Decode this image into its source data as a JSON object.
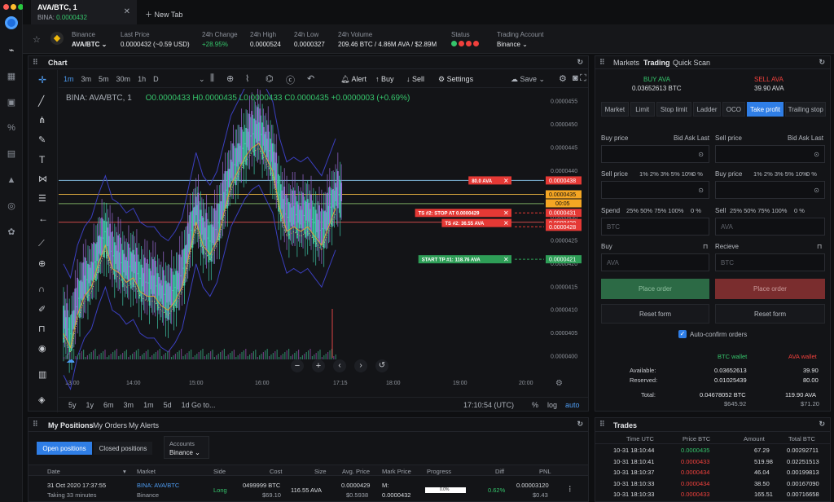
{
  "window": {
    "tab_title": "AVA/BTC, 1",
    "tab_subtitle_pair": "BINA:",
    "tab_subtitle_price": "0.0000432",
    "new_tab": "New Tab"
  },
  "infobar": {
    "exchange": "Binance",
    "pair": "AVA/BTC",
    "last_price_label": "Last Price",
    "last_price": "0.0000432 (~0.59 USD)",
    "change_label": "24h Change",
    "change": "+28.95%",
    "high_label": "24h High",
    "high": "0.0000524",
    "low_label": "24h Low",
    "low": "0.0000327",
    "volume_label": "24h Volume",
    "volume": "209.46 BTC / 4.86M AVA / $2.89M",
    "status_label": "Status",
    "account_label": "Trading Account",
    "account": "Binance"
  },
  "chart_panel": {
    "title": "Chart",
    "timeframes": [
      "1m",
      "3m",
      "5m",
      "30m",
      "1h",
      "D"
    ],
    "alert": "Alert",
    "buy": "Buy",
    "sell": "Sell",
    "settings": "Settings",
    "save": "Save",
    "legend_symbol": "BINA: AVA/BTC, 1",
    "legend_ohlc": "O0.0000433  H0.0000435  L0.0000433  C0.0000435  +0.0000003 (+0.69%)",
    "ranges": [
      "5y",
      "1y",
      "6m",
      "3m",
      "1m",
      "5d",
      "1d"
    ],
    "goto": "Go to...",
    "clock": "17:10:54 (UTC)",
    "pct": "%",
    "log": "log",
    "auto": "auto"
  },
  "chart_data": {
    "type": "candlestick",
    "y_ticks": [
      "0.0000455",
      "0.0000450",
      "0.0000445",
      "0.0000440",
      "0.0000435",
      "0.0000430",
      "0.0000425",
      "0.0000420",
      "0.0000415",
      "0.0000410",
      "0.0000405",
      "0.0000400"
    ],
    "x_ticks": [
      "13:00",
      "14:00",
      "15:00",
      "16:00",
      "17:15",
      "18:00",
      "19:00",
      "20:00"
    ],
    "ylim": [
      3.98e-05,
      4.56e-05
    ],
    "close_path": [
      4.08e-05,
      4.05e-05,
      4.12e-05,
      4.16e-05,
      4.18e-05,
      4.23e-05,
      4.27e-05,
      4.22e-05,
      4.21e-05,
      4.19e-05,
      4.2e-05,
      4.17e-05,
      4.16e-05,
      4.16e-05,
      4.14e-05,
      4.13e-05,
      4.15e-05,
      4.18e-05,
      4.25e-05,
      4.32e-05,
      4.27e-05,
      4.25e-05,
      4.28e-05,
      4.34e-05,
      4.4e-05,
      4.43e-05,
      4.46e-05,
      4.48e-05,
      4.49e-05,
      4.46e-05,
      4.43e-05,
      4.35e-05,
      4.3e-05,
      4.31e-05,
      4.3e-05,
      4.31e-05,
      4.29e-05,
      4.27e-05,
      4.31e-05,
      4.35e-05
    ],
    "order_labels": [
      {
        "text": "80.0 AVA",
        "price": "0.0000438",
        "color": "#e53935"
      },
      {
        "text": "TS #2: STOP AT 0.0000429",
        "price": "0.0000431",
        "color": "#e53935"
      },
      {
        "text": "TS #2: 36.55 AVA",
        "price": "0.0000429",
        "color": "#e53935"
      },
      {
        "text": "START TP #1: 118.76 AVA",
        "price": "0.0000421",
        "color": "#2e9e57"
      }
    ],
    "last_price_tag": "0.0000435",
    "countdown_tag": "00:05",
    "extra_tag": "0.0000428"
  },
  "order_panel": {
    "tabs": [
      "Markets",
      "Trading",
      "Quick Scan"
    ],
    "buy_label": "BUY AVA",
    "buy_value": "0.03652613 BTC",
    "sell_label": "SELL AVA",
    "sell_value": "39.90 AVA",
    "order_types": [
      "Market",
      "Limit",
      "Stop limit",
      "Ladder",
      "OCO",
      "Take profit",
      "Trailing stop"
    ],
    "buy_price": "Buy price",
    "bid_ask_last": "Bid Ask Last",
    "sell_price": "Sell price",
    "pcts": "1% 2% 3% 5% 10%",
    "zero_pct": "0 %",
    "spend": "Spend",
    "spend_pcts": "25% 50% 75% 100%",
    "sell": "Sell",
    "sell_pcts": "25% 50% 75% 100%",
    "btc": "BTC",
    "ava": "AVA",
    "buy": "Buy",
    "recieve": "Recieve",
    "place_order": "Place order",
    "reset_form": "Reset form",
    "auto_confirm": "Auto-confirm orders",
    "btc_wallet": "BTC wallet",
    "ava_wallet": "AVA wallet",
    "available": "Available:",
    "reserved": "Reserved:",
    "total": "Total:",
    "btc_available": "0.03652613",
    "btc_reserved": "0.01025439",
    "btc_total": "0.04678052 BTC",
    "btc_total_usd": "$645.92",
    "ava_available": "39.90",
    "ava_reserved": "80.00",
    "ava_total": "119.90 AVA",
    "ava_total_usd": "$71.20"
  },
  "positions": {
    "tabs": [
      "My Positions",
      "My Orders",
      "My Alerts"
    ],
    "open": "Open positions",
    "closed": "Closed positions",
    "accounts_label": "Accounts",
    "accounts_value": "Binance",
    "headers": [
      "Date",
      "Market",
      "Side",
      "Cost",
      "Size",
      "Avg. Price",
      "Mark Price",
      "Progress",
      "Diff",
      "PNL"
    ],
    "row": {
      "date": "31 Oct 2020 17:37:55",
      "duration": "Taking 33 minutes",
      "market": "BINA: AVA/BTC",
      "exchange": "Binance",
      "side": "Long",
      "cost": "0499999 BTC",
      "cost_usd": "$69.10",
      "size": "116.55 AVA",
      "avg": "0.0000429",
      "avg_usd": "$0.5938",
      "mark_lbl": "M:",
      "mark": "0.0000432",
      "progress": "0.0%",
      "diff": "0.62%",
      "pnl": "0.00003120",
      "pnl_usd": "$0.43"
    }
  },
  "trades": {
    "title": "Trades",
    "headers": [
      "Time UTC",
      "Price BTC",
      "Amount",
      "Total BTC"
    ],
    "rows": [
      {
        "time": "10-31 18:10:44",
        "price": "0.0000435",
        "amount": "67.29",
        "total": "0.00292711",
        "side": "buy"
      },
      {
        "time": "10-31 18:10:41",
        "price": "0.0000433",
        "amount": "519.98",
        "total": "0.02251513",
        "side": "sell"
      },
      {
        "time": "10-31 18:10:37",
        "price": "0.0000434",
        "amount": "46.04",
        "total": "0.00199813",
        "side": "sell"
      },
      {
        "time": "10-31 18:10:33",
        "price": "0.0000434",
        "amount": "38.50",
        "total": "0.00167090",
        "side": "sell"
      },
      {
        "time": "10-31 18:10:33",
        "price": "0.0000433",
        "amount": "165.51",
        "total": "0.00716658",
        "side": "sell"
      }
    ]
  }
}
